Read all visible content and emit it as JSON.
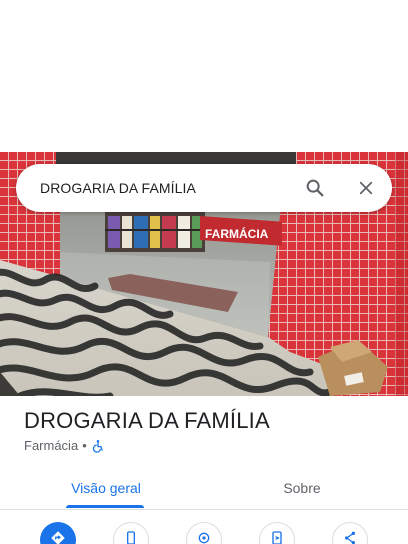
{
  "search": {
    "query": "DROGARIA DA FAMÍLIA",
    "search_icon": "search-icon",
    "close_icon": "close-icon"
  },
  "photo": {
    "storefront_sign": "FARMÁCIA"
  },
  "place": {
    "name": "DROGARIA DA FAMÍLIA",
    "category": "Farmácia",
    "separator": "•",
    "accessibility_icon": "wheelchair-accessible-icon",
    "accessibility_color": "#1a73e8"
  },
  "tabs": [
    {
      "label": "Visão geral",
      "active": true
    },
    {
      "label": "Sobre",
      "active": false
    }
  ],
  "actions": [
    {
      "icon": "directions-icon",
      "style": "primary"
    },
    {
      "icon": "phone-icon",
      "style": "outline"
    },
    {
      "icon": "nearby-icon",
      "style": "outline"
    },
    {
      "icon": "send-to-phone-icon",
      "style": "outline"
    },
    {
      "icon": "share-icon",
      "style": "outline"
    }
  ],
  "colors": {
    "accent": "#1a73e8",
    "text_primary": "#202124",
    "text_secondary": "#5f6368"
  }
}
